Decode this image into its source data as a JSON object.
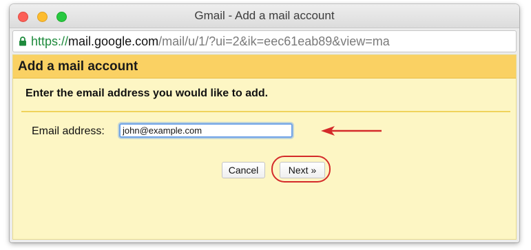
{
  "window": {
    "title": "Gmail - Add a mail account"
  },
  "urlbar": {
    "scheme": "https://",
    "host": "mail.google.com",
    "path": "/mail/u/1/?ui=2&ik=eec61eab89&view=ma",
    "icon": "lock-icon"
  },
  "dialog": {
    "header": "Add a mail account",
    "instruction": "Enter the email address you would like to add.",
    "email_label": "Email address:",
    "email_value": "john@example.com",
    "cancel_label": "Cancel",
    "next_label": "Next »"
  },
  "annotations": {
    "arrow_color": "#d42a2a",
    "ring_color": "#d42a2a"
  }
}
